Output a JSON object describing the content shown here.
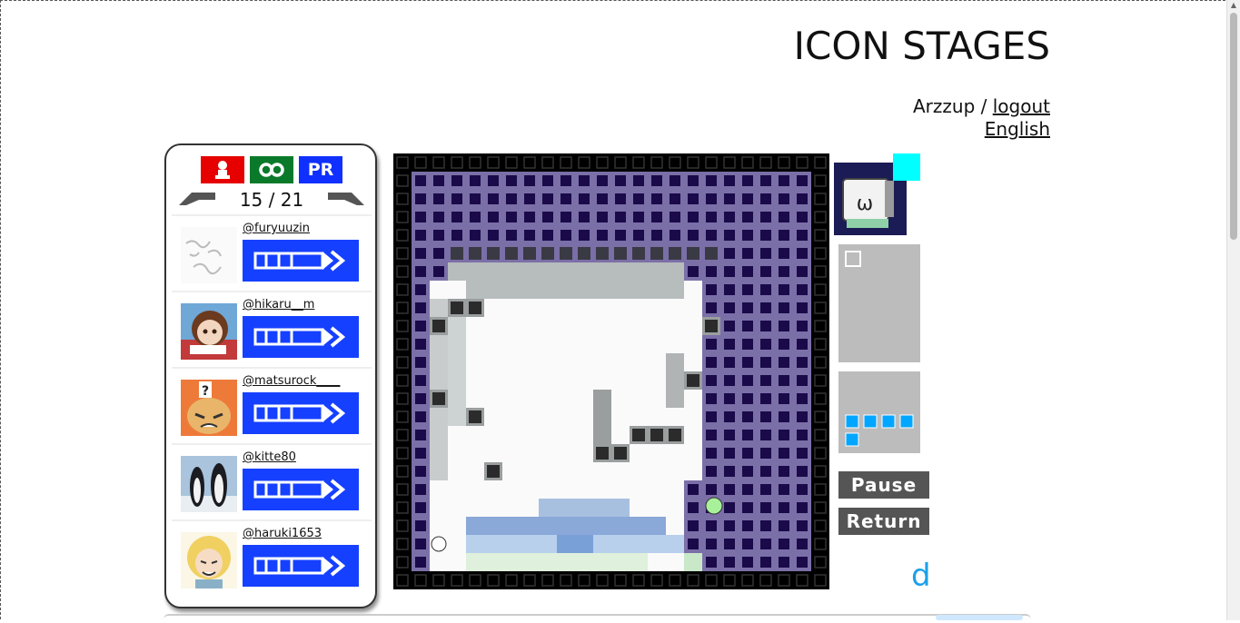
{
  "header": {
    "title": "ICON STAGES",
    "username": "Arzzup",
    "separator": "/",
    "logout": "logout",
    "language": "English"
  },
  "panel": {
    "mode_buttons": [
      {
        "label": "",
        "icon": "person-icon",
        "color": "#e60000"
      },
      {
        "label": "",
        "icon": "infinity-icon",
        "color": "#0a7a2a"
      },
      {
        "label": "PR",
        "icon": "",
        "color": "#1030ff"
      }
    ],
    "page": "15 / 21",
    "users": [
      {
        "handle": "@furyuuzin"
      },
      {
        "handle": "@hikaru__m"
      },
      {
        "handle": "@matsurock____"
      },
      {
        "handle": "@kitte80"
      },
      {
        "handle": "@haruki1653"
      }
    ]
  },
  "controls": {
    "pause": "Pause",
    "return": "Return"
  },
  "stray_text": "d",
  "colors": {
    "play_button": "#1640ff",
    "purple_cell": "#7b6fa8",
    "dark_cell": "#1a0a4a",
    "ball_green": "#a8f09a",
    "hold_piece": "#00a6ff",
    "cyan": "#00ffff"
  }
}
